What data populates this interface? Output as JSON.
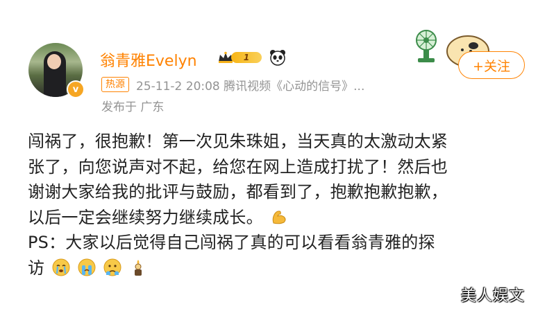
{
  "profile": {
    "name": "翁青雅Evelyn",
    "level": "1",
    "verified_mark": "v"
  },
  "meta": {
    "hot_tag": "热源",
    "timestamp_source": "25-11-2 20:08  腾讯视频《心动的信号》...",
    "location": "发布于 广东"
  },
  "actions": {
    "follow_label": "+关注"
  },
  "post": {
    "lines": [
      "闯祸了，很抱歉！第一次见朱珠姐，当天真的太激动太紧",
      "张了，向您说声对不起，给您在网上造成打扰了！然后也",
      "谢谢大家给我的批评与鼓励，都看到了，抱歉抱歉抱歉，",
      "以后一定会继续努力继续成长。",
      "PS：大家以后觉得自己闯祸了真的可以看看翁青雅的探",
      "访"
    ],
    "emojis": [
      "flexed-biceps-icon",
      "crying-face-icon",
      "loudly-crying-face-icon",
      "tearful-face-icon",
      "candle-figure-icon"
    ]
  },
  "watermark": "美人娱文",
  "colors": {
    "accent": "#ff8200",
    "meta_gray": "#939393",
    "text": "#222222"
  }
}
